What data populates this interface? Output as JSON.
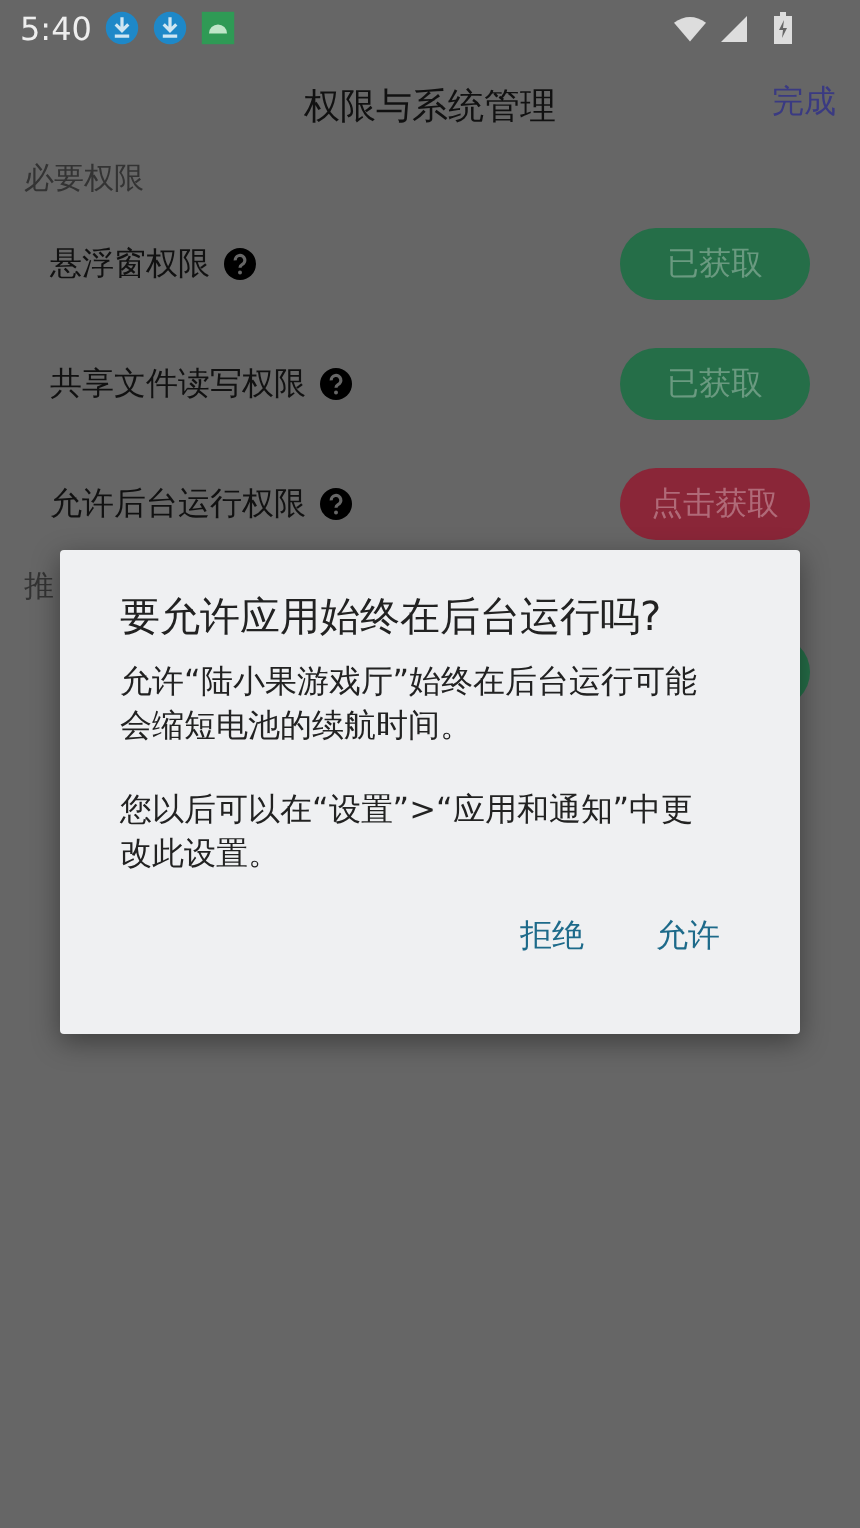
{
  "status_bar": {
    "time": "5:40",
    "notifications": [
      {
        "kind": "download"
      },
      {
        "kind": "download"
      },
      {
        "kind": "android"
      }
    ]
  },
  "header": {
    "title": "权限与系统管理",
    "action": "完成"
  },
  "sections": [
    {
      "title": "必要权限",
      "rows": [
        {
          "label": "悬浮窗权限",
          "button": "已获取",
          "granted": true
        },
        {
          "label": "共享文件读写权限",
          "button": "已获取",
          "granted": true
        },
        {
          "label": "允许后台运行权限",
          "button": "点击获取",
          "granted": false
        }
      ]
    },
    {
      "title": "推",
      "rows": [
        {
          "granted": true
        }
      ]
    }
  ],
  "dialog": {
    "title": "要允许应用始终在后台运行吗?",
    "paragraphs": [
      "允许“陆小果游戏厅”始终在后台运行可能会缩短电池的续航时间。",
      "您以后可以在“设置”>“应用和通知”中更改此设置。"
    ],
    "buttons": [
      "拒绝",
      "允许"
    ]
  }
}
